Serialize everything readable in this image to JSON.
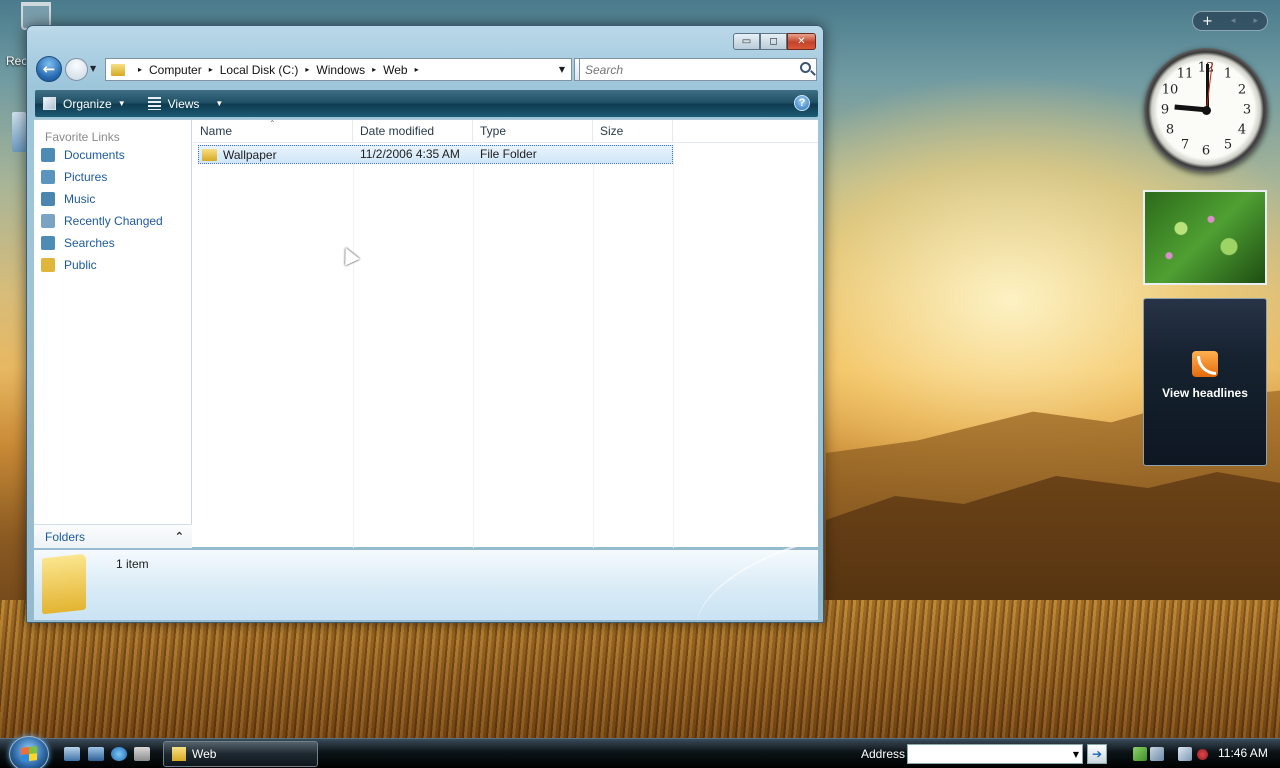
{
  "desktop": {
    "recycle_bin_label": "Rec"
  },
  "window": {
    "caption_buttons": {
      "minimize": "▭",
      "maximize": "◻",
      "close": "✕"
    },
    "address": {
      "crumbs": [
        "Computer",
        "Local Disk (C:)",
        "Windows",
        "Web"
      ],
      "separator": "▸"
    },
    "search_placeholder": "Search",
    "commands": {
      "organize_label": "Organize",
      "views_label": "Views",
      "help_label": "?"
    },
    "nav_pane": {
      "header": "Favorite Links",
      "items": [
        {
          "label": "Documents",
          "color": "#4d8bb5"
        },
        {
          "label": "Pictures",
          "color": "#5b95bf"
        },
        {
          "label": "Music",
          "color": "#4a86b0"
        },
        {
          "label": "Recently Changed",
          "color": "#7aa3c4"
        },
        {
          "label": "Searches",
          "color": "#4f8cb5"
        },
        {
          "label": "Public",
          "color": "#e0b53b"
        }
      ],
      "folders_label": "Folders",
      "folders_chevron": "⌃"
    },
    "columns": [
      "Name",
      "Date modified",
      "Type",
      "Size"
    ],
    "rows": [
      {
        "name": "Wallpaper",
        "date_modified": "11/2/2006 4:35 AM",
        "type": "File Folder",
        "size": ""
      }
    ],
    "details": {
      "item_count": "1 item"
    }
  },
  "sidebar": {
    "controls": [
      "+",
      "◂",
      "▸"
    ],
    "clock_numbers": [
      "12",
      "1",
      "2",
      "3",
      "4",
      "5",
      "6",
      "7",
      "8",
      "9",
      "10",
      "11"
    ],
    "feed_label": "View headlines"
  },
  "taskbar": {
    "task_label": "Web",
    "address_label": "Address",
    "go_label": "➔",
    "time": "11:46 AM"
  }
}
